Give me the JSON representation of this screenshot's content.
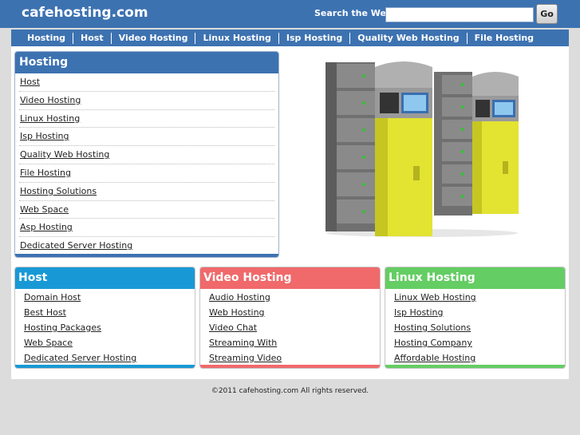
{
  "header": {
    "site_title": "cafehosting.com",
    "search_label": "Search the Web:",
    "search_value": "",
    "go_label": "Go"
  },
  "nav": {
    "items": [
      "Hosting",
      "Host",
      "Video Hosting",
      "Linux Hosting",
      "Isp Hosting",
      "Quality Web Hosting",
      "File Hosting"
    ]
  },
  "hosting_box": {
    "title": "Hosting",
    "items": [
      "Host",
      "Video Hosting",
      "Linux Hosting",
      "Isp Hosting",
      "Quality Web Hosting",
      "File Hosting",
      "Hosting Solutions",
      "Web Space",
      "Asp Hosting",
      "Dedicated Server Hosting"
    ]
  },
  "columns": [
    {
      "title": "Host",
      "color": "#1899d6",
      "items": [
        "Domain Host",
        "Best Host",
        "Hosting Packages",
        "Web Space",
        "Dedicated Server Hosting"
      ]
    },
    {
      "title": "Video Hosting",
      "color": "#f0696b",
      "items": [
        "Audio Hosting",
        "Web Hosting",
        "Video Chat",
        "Streaming With",
        "Streaming Video"
      ]
    },
    {
      "title": "Linux Hosting",
      "color": "#64cd63",
      "items": [
        "Linux Web Hosting",
        "Isp Hosting",
        "Hosting Solutions",
        "Hosting Company",
        "Affordable Hosting"
      ]
    }
  ],
  "footer": {
    "text": "©2011 cafehosting.com All rights reserved."
  },
  "colors": {
    "brand_blue": "#3d72b1",
    "server_yellow": "#dede2f",
    "server_gray": "#6c6c6c"
  },
  "icons": {
    "hero_image": "server-rack-illustration"
  }
}
